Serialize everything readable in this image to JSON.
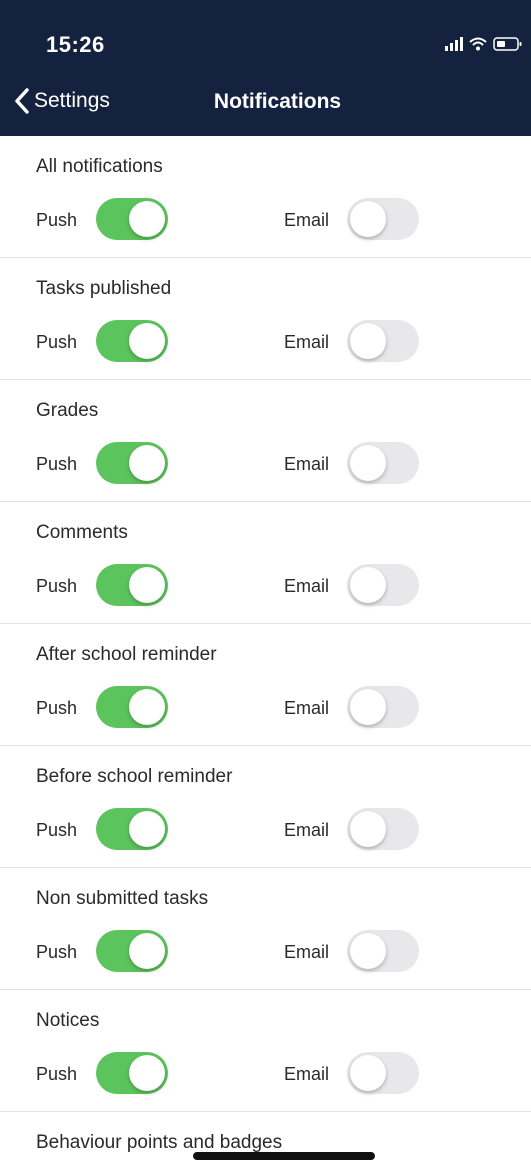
{
  "status_bar": {
    "time": "15:26",
    "signal_icon": "cellular-signal-icon",
    "wifi_icon": "wifi-icon",
    "battery_icon": "battery-icon"
  },
  "nav": {
    "back_label": "Settings",
    "title": "Notifications"
  },
  "labels": {
    "push": "Push",
    "email": "Email"
  },
  "colors": {
    "header_bg": "#14223f",
    "toggle_on": "#5cc45c",
    "toggle_off": "#e8e8ea"
  },
  "sections": [
    {
      "title": "All notifications",
      "push": true,
      "email": false
    },
    {
      "title": "Tasks published",
      "push": true,
      "email": false
    },
    {
      "title": "Grades",
      "push": true,
      "email": false
    },
    {
      "title": "Comments",
      "push": true,
      "email": false
    },
    {
      "title": "After school reminder",
      "push": true,
      "email": false
    },
    {
      "title": "Before school reminder",
      "push": true,
      "email": false
    },
    {
      "title": "Non submitted tasks",
      "push": true,
      "email": false
    },
    {
      "title": "Notices",
      "push": true,
      "email": false
    },
    {
      "title": "Behaviour points and badges"
    }
  ]
}
